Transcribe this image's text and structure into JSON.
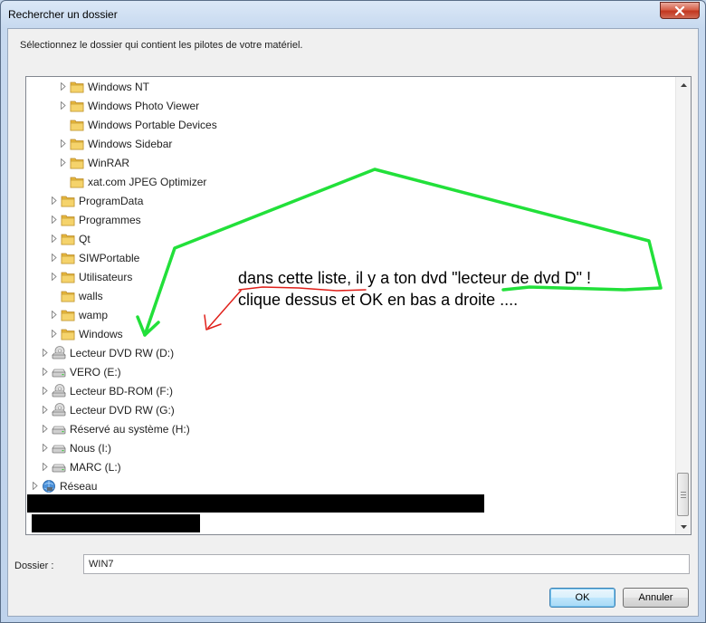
{
  "window": {
    "title": "Rechercher un dossier",
    "close_icon": "close-icon"
  },
  "instruction": "Sélectionnez le dossier qui contient les pilotes de votre matériel.",
  "tree": {
    "items": [
      {
        "label": "Windows NT",
        "level": 3,
        "icon": "folder",
        "expander": true
      },
      {
        "label": "Windows Photo Viewer",
        "level": 3,
        "icon": "folder",
        "expander": true
      },
      {
        "label": "Windows Portable Devices",
        "level": 3,
        "icon": "folder",
        "expander": false
      },
      {
        "label": "Windows Sidebar",
        "level": 3,
        "icon": "folder",
        "expander": true
      },
      {
        "label": "WinRAR",
        "level": 3,
        "icon": "folder",
        "expander": true
      },
      {
        "label": "xat.com JPEG Optimizer",
        "level": 3,
        "icon": "folder",
        "expander": false
      },
      {
        "label": "ProgramData",
        "level": 2,
        "icon": "folder",
        "expander": true
      },
      {
        "label": "Programmes",
        "level": 2,
        "icon": "folder",
        "expander": true
      },
      {
        "label": "Qt",
        "level": 2,
        "icon": "folder",
        "expander": true
      },
      {
        "label": "SIWPortable",
        "level": 2,
        "icon": "folder",
        "expander": true
      },
      {
        "label": "Utilisateurs",
        "level": 2,
        "icon": "folder",
        "expander": true
      },
      {
        "label": "walls",
        "level": 2,
        "icon": "folder",
        "expander": false
      },
      {
        "label": "wamp",
        "level": 2,
        "icon": "folder",
        "expander": true
      },
      {
        "label": "Windows",
        "level": 2,
        "icon": "folder",
        "expander": true
      },
      {
        "label": "Lecteur DVD RW (D:)",
        "level": 1,
        "icon": "optical-drive",
        "expander": true
      },
      {
        "label": "VERO (E:)",
        "level": 1,
        "icon": "hard-drive",
        "expander": true
      },
      {
        "label": "Lecteur BD-ROM (F:)",
        "level": 1,
        "icon": "optical-drive",
        "expander": true
      },
      {
        "label": "Lecteur DVD RW (G:)",
        "level": 1,
        "icon": "optical-drive",
        "expander": true
      },
      {
        "label": "Réservé au système (H:)",
        "level": 1,
        "icon": "hard-drive",
        "expander": true
      },
      {
        "label": "Nous (I:)",
        "level": 1,
        "icon": "hard-drive",
        "expander": true
      },
      {
        "label": "MARC (L:)",
        "level": 1,
        "icon": "hard-drive",
        "expander": true
      },
      {
        "label": "Réseau",
        "level": 0,
        "icon": "network",
        "expander": true
      }
    ]
  },
  "annotation": {
    "line1": "dans cette liste, il y a ton dvd \"lecteur de dvd D\" !",
    "line2": "clique dessus et OK en bas a droite ....",
    "green_color": "#22e03a",
    "red_color": "#e0201a"
  },
  "folder": {
    "label": "Dossier :",
    "value": "WIN7"
  },
  "buttons": {
    "ok": "OK",
    "cancel": "Annuler"
  }
}
